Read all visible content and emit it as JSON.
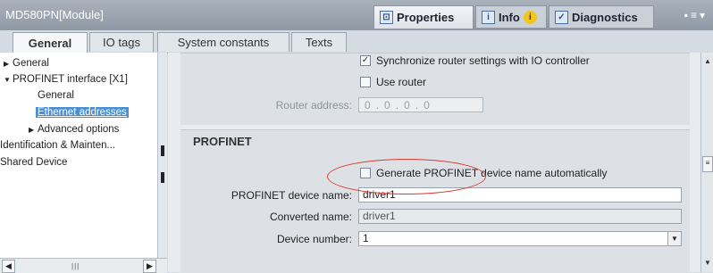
{
  "window": {
    "title": "MD580PN[Module]"
  },
  "panel_tabs": [
    {
      "label": "Properties",
      "icon": "properties-icon"
    },
    {
      "label": "Info",
      "icon": "info-icon"
    },
    {
      "label": "Diagnostics",
      "icon": "diagnostics-icon"
    }
  ],
  "sub_tabs": [
    "General",
    "IO tags",
    "System constants",
    "Texts"
  ],
  "tree": {
    "items": [
      {
        "label": "General",
        "expander": "▶"
      },
      {
        "label": "PROFINET interface [X1]",
        "expander": "▼"
      },
      {
        "label": "General"
      },
      {
        "label": "Ethernet addresses"
      },
      {
        "label": "Advanced options",
        "expander": "▶"
      },
      {
        "label": "Identification & Mainten..."
      },
      {
        "label": "Shared Device"
      }
    ]
  },
  "router": {
    "sync_label": "Synchronize router settings with IO controller",
    "sync_checked": true,
    "use_router_label": "Use router",
    "use_router_checked": false,
    "address_label": "Router address:",
    "address_octets": [
      "0",
      "0",
      "0",
      "0"
    ]
  },
  "profinet": {
    "heading": "PROFINET",
    "auto_name_label": "Generate PROFINET device name automatically",
    "auto_name_checked": false,
    "device_name_label": "PROFINET device name:",
    "device_name_value": "driver1",
    "converted_label": "Converted name:",
    "converted_value": "driver1",
    "device_number_label": "Device number:",
    "device_number_value": "1"
  },
  "colors": {
    "selection": "#4a8fd4",
    "highlight_oval": "#d9392f"
  }
}
